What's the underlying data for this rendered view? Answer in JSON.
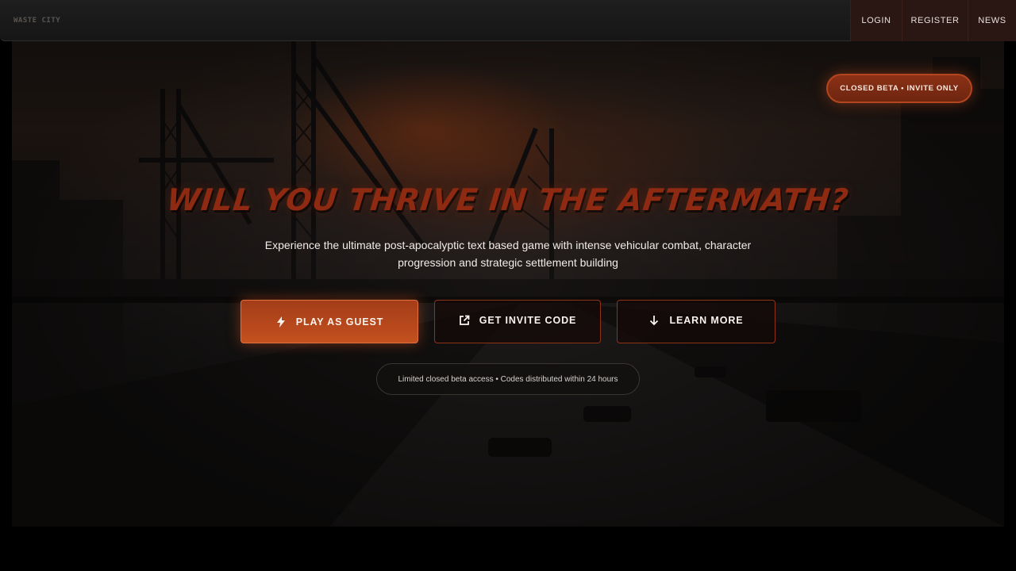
{
  "app": {
    "logo_text": "WASTE CITY"
  },
  "nav": {
    "login": "LOGIN",
    "register": "REGISTER",
    "news": "NEWS"
  },
  "badge": "CLOSED BETA • INVITE ONLY",
  "hero": {
    "headline": "WILL YOU THRIVE IN THE AFTERMATH?",
    "subtitle": "Experience the ultimate post-apocalyptic text based game with intense vehicular combat, character progression and strategic settlement building"
  },
  "buttons": {
    "guest": {
      "label": "PLAY AS GUEST",
      "icon": "lightning-icon"
    },
    "invite": {
      "label": "GET INVITE CODE",
      "icon": "external-link-icon"
    },
    "learn": {
      "label": "LEARN MORE",
      "icon": "arrow-down-icon"
    }
  },
  "notice": "Limited closed beta access • Codes distributed within 24 hours",
  "colors": {
    "accent": "#c4501f",
    "accent_dark": "#8e3317",
    "headline": "#8e2a12",
    "background": "#000000"
  }
}
